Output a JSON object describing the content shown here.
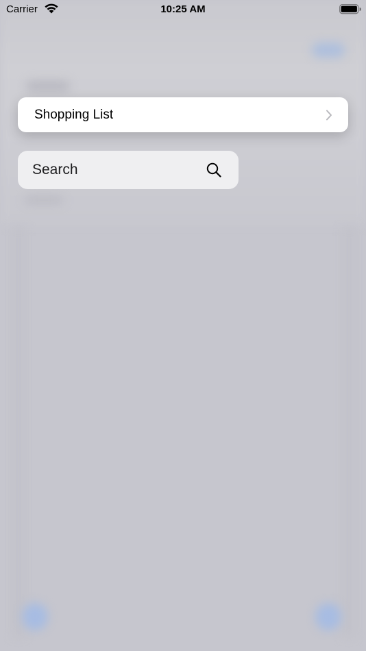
{
  "status_bar": {
    "carrier": "Carrier",
    "time": "10:25 AM",
    "icons": [
      "wifi-icon",
      "battery-icon"
    ]
  },
  "menu": {
    "item_label": "Shopping List",
    "icon": "chevron-right-icon"
  },
  "search": {
    "placeholder": "Search",
    "value": "",
    "icon": "search-icon"
  },
  "colors": {
    "background": "#c6c6ce",
    "card": "#ffffff",
    "search_field": "#efeff1",
    "accent_blur": "#a7bce2",
    "chevron": "#b8b8bd"
  }
}
